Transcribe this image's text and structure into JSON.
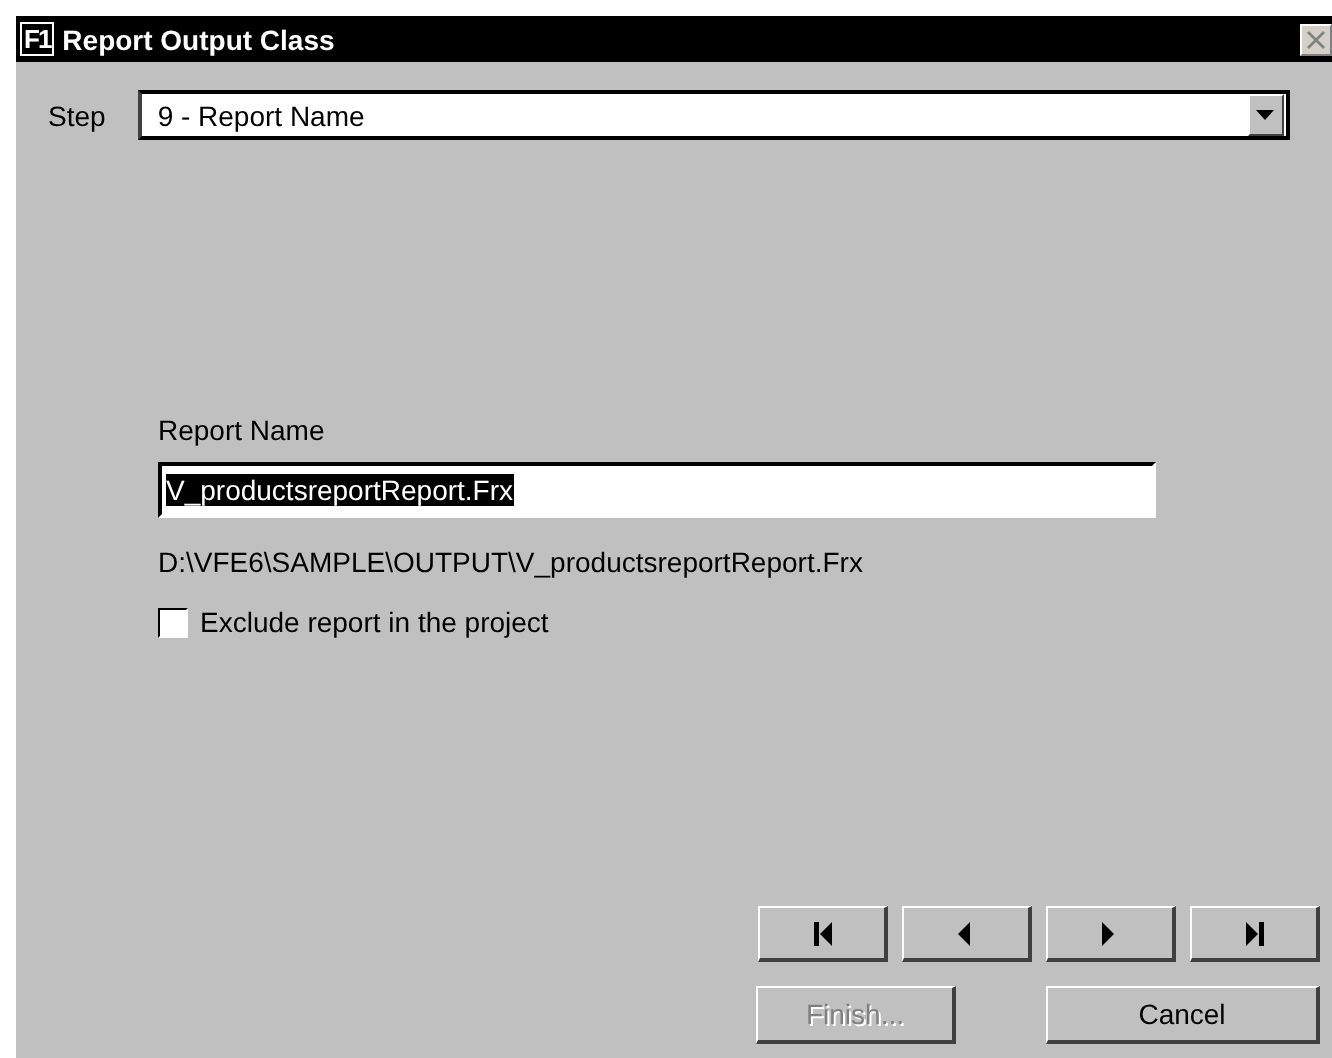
{
  "window": {
    "app_icon": "F1",
    "title": "Report Output Class"
  },
  "step": {
    "label": "Step",
    "value": "9 - Report Name"
  },
  "report_name": {
    "label": "Report Name",
    "value": "V_productsreportReport.Frx",
    "selected_text": true,
    "path": "D:\\VFE6\\SAMPLE\\OUTPUT\\V_productsreportReport.Frx"
  },
  "exclude": {
    "label": "Exclude report in the project",
    "checked": false
  },
  "nav_buttons": [
    {
      "kind": "first",
      "disabled": false
    },
    {
      "kind": "previous",
      "disabled": false
    },
    {
      "kind": "next",
      "disabled": false
    },
    {
      "kind": "last",
      "disabled": false
    }
  ],
  "buttons": [
    {
      "label": "Finish...",
      "disabled": true
    },
    {
      "label": "Cancel",
      "disabled": false
    }
  ]
}
